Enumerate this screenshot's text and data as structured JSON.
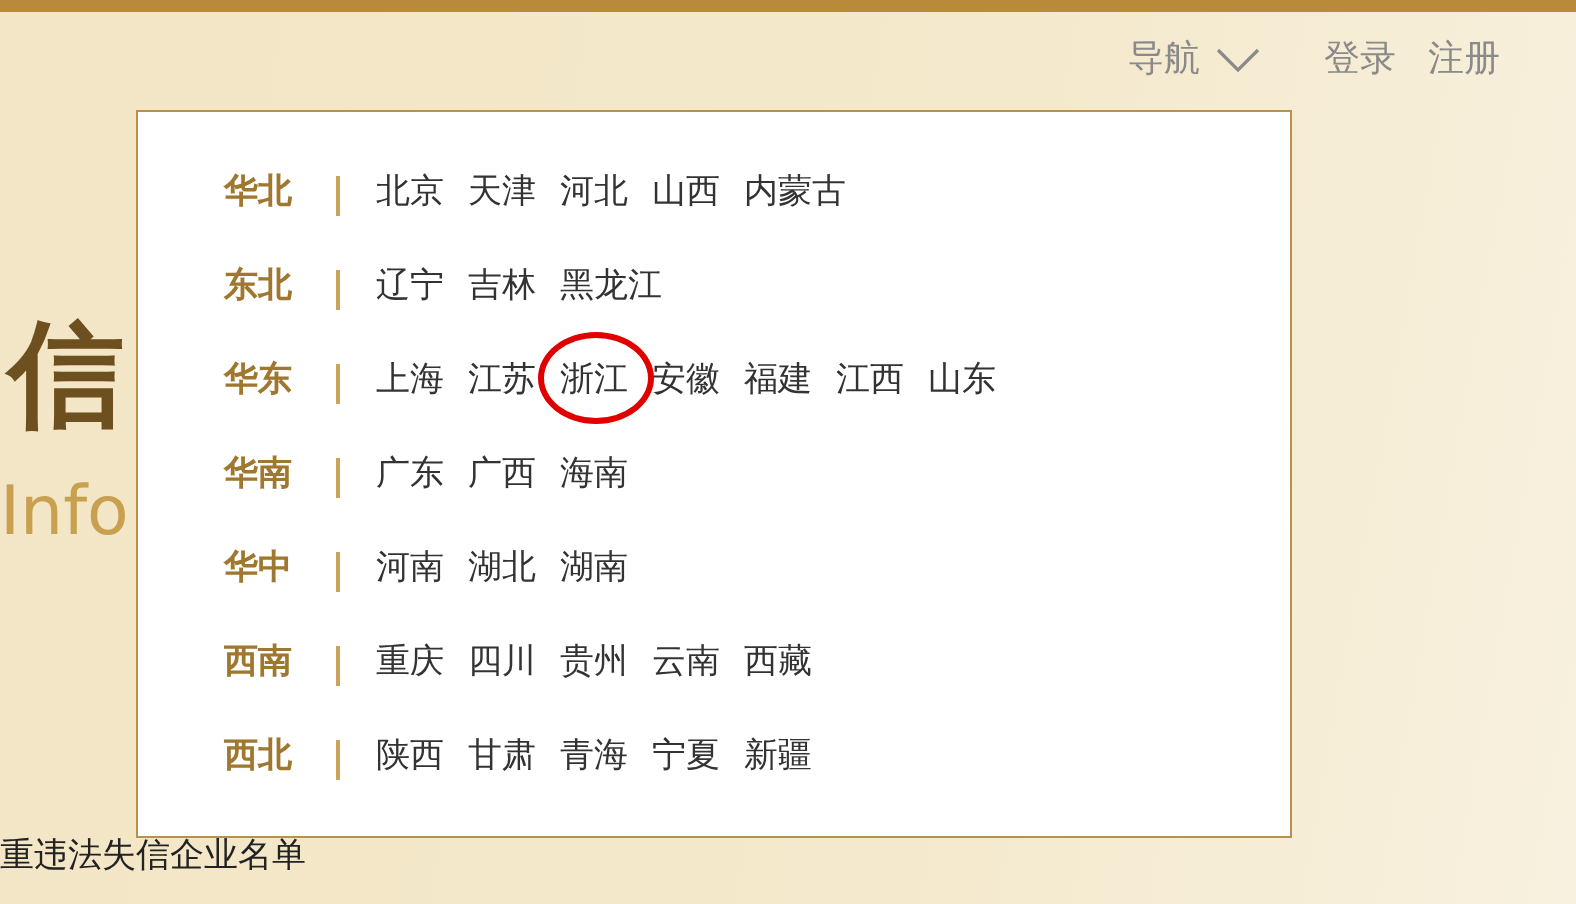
{
  "header": {
    "nav_label": "导航",
    "links": [
      "登录",
      "注册"
    ]
  },
  "logo": {
    "title": "信",
    "subtitle": "Info"
  },
  "dropdown": {
    "regions": [
      {
        "name": "华北",
        "provinces": [
          {
            "label": "北京",
            "circled": false
          },
          {
            "label": "天津",
            "circled": false
          },
          {
            "label": "河北",
            "circled": false
          },
          {
            "label": "山西",
            "circled": false
          },
          {
            "label": "内蒙古",
            "circled": false
          }
        ]
      },
      {
        "name": "东北",
        "provinces": [
          {
            "label": "辽宁",
            "circled": false
          },
          {
            "label": "吉林",
            "circled": false
          },
          {
            "label": "黑龙江",
            "circled": false
          }
        ]
      },
      {
        "name": "华东",
        "provinces": [
          {
            "label": "上海",
            "circled": false
          },
          {
            "label": "江苏",
            "circled": false
          },
          {
            "label": "浙江",
            "circled": true
          },
          {
            "label": "安徽",
            "circled": false
          },
          {
            "label": "福建",
            "circled": false
          },
          {
            "label": "江西",
            "circled": false
          },
          {
            "label": "山东",
            "circled": false
          }
        ]
      },
      {
        "name": "华南",
        "provinces": [
          {
            "label": "广东",
            "circled": false
          },
          {
            "label": "广西",
            "circled": false
          },
          {
            "label": "海南",
            "circled": false
          }
        ]
      },
      {
        "name": "华中",
        "provinces": [
          {
            "label": "河南",
            "circled": false
          },
          {
            "label": "湖北",
            "circled": false
          },
          {
            "label": "湖南",
            "circled": false
          }
        ]
      },
      {
        "name": "西南",
        "provinces": [
          {
            "label": "重庆",
            "circled": false
          },
          {
            "label": "四川",
            "circled": false
          },
          {
            "label": "贵州",
            "circled": false
          },
          {
            "label": "云南",
            "circled": false
          },
          {
            "label": "西藏",
            "circled": false
          }
        ]
      },
      {
        "name": "西北",
        "provinces": [
          {
            "label": "陕西",
            "circled": false
          },
          {
            "label": "甘肃",
            "circled": false
          },
          {
            "label": "青海",
            "circled": false
          },
          {
            "label": "宁夏",
            "circled": false
          },
          {
            "label": "新疆",
            "circled": false
          }
        ]
      }
    ]
  },
  "footer_text": "重违法失信企业名单"
}
